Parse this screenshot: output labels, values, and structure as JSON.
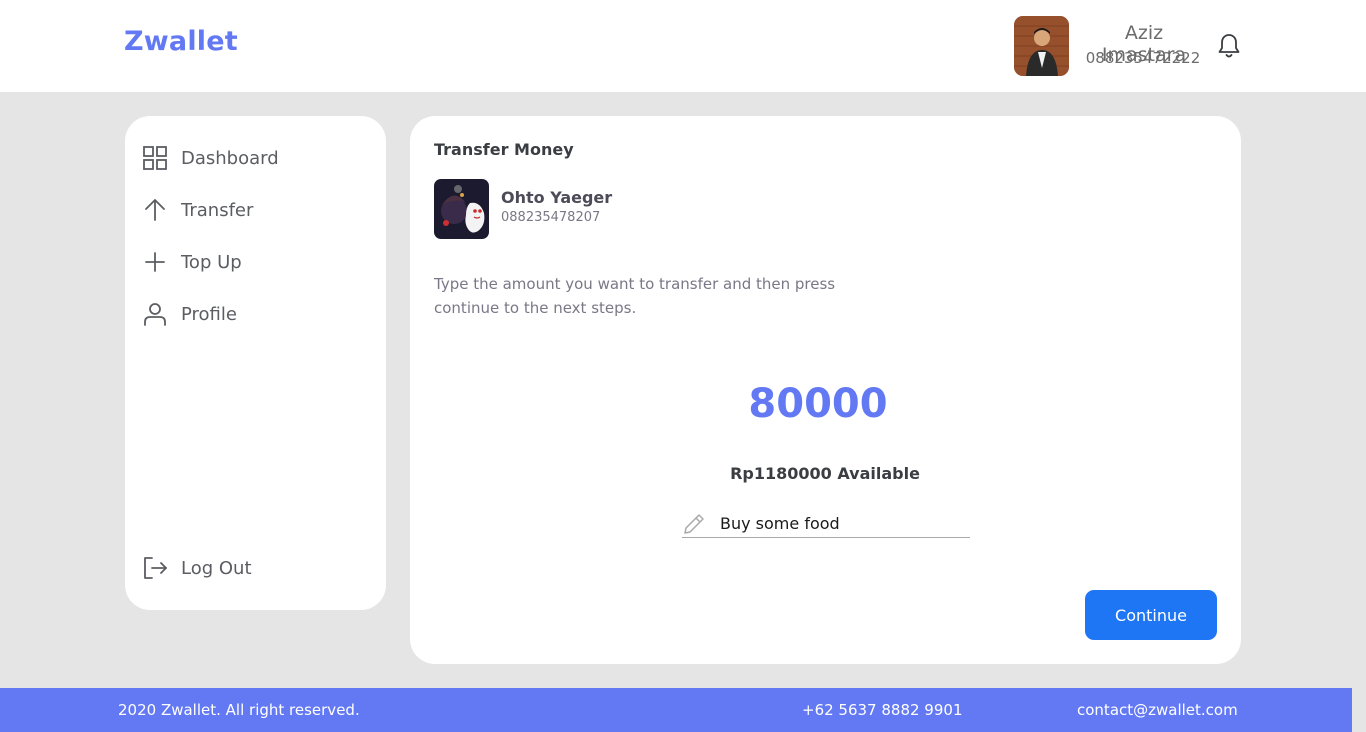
{
  "header": {
    "logo": "Zwallet",
    "user_name": "Aziz Imastara",
    "user_phone": "088235472222"
  },
  "sidebar": {
    "items": [
      {
        "label": "Dashboard",
        "icon": "grid-icon"
      },
      {
        "label": "Transfer",
        "icon": "arrow-up-icon"
      },
      {
        "label": "Top Up",
        "icon": "plus-icon"
      },
      {
        "label": "Profile",
        "icon": "user-icon"
      }
    ],
    "logout_label": "Log Out"
  },
  "transfer": {
    "title": "Transfer Money",
    "recipient_name": "Ohto Yaeger",
    "recipient_phone": "088235478207",
    "instructions": "Type the amount you want to transfer and then press continue to the next steps.",
    "amount": "80000",
    "available": "Rp1180000 Available",
    "notes_value": "Buy some food",
    "continue_label": "Continue"
  },
  "footer": {
    "copyright": "2020 Zwallet. All right reserved.",
    "phone": "+62 5637 8882 9901",
    "email": "contact@zwallet.com"
  },
  "colors": {
    "brand": "#6379f4",
    "button": "#1e76f5",
    "background": "#e5e5e5"
  }
}
